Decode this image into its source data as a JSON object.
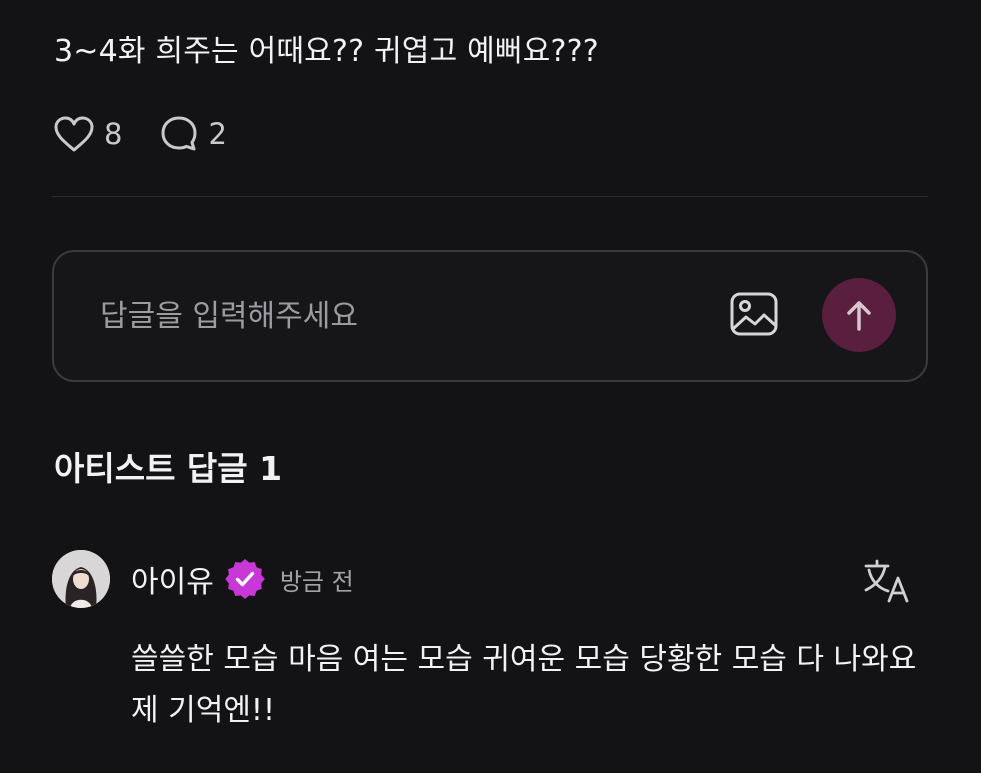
{
  "post": {
    "text": "3~4화 희주는 어때요?? 귀엽고 예뻐요???",
    "likes": "8",
    "comments": "2"
  },
  "reply_input": {
    "placeholder": "답글을 입력해주세요"
  },
  "artist_replies": {
    "title": "아티스트 답글 1",
    "items": [
      {
        "author": "아이유",
        "time": "방금 전",
        "text": "쓸쓸한 모습 마음 여는 모습 귀여운 모습 당황한 모습 다 나와요 제 기억엔!!"
      }
    ]
  },
  "icons": {
    "like": "heart-icon",
    "comment": "comment-bubble-icon",
    "image": "image-icon",
    "send": "arrow-up-icon",
    "verified": "verified-badge-icon",
    "translate": "translate-icon"
  },
  "colors": {
    "background": "#131214",
    "accent": "#c838d6",
    "send_button": "#5a1e3f"
  }
}
